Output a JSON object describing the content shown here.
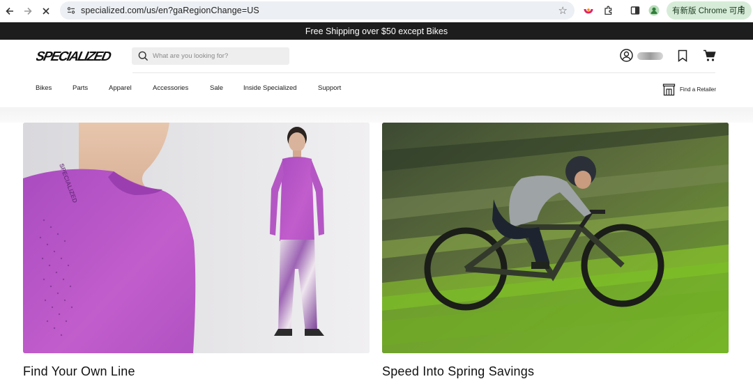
{
  "browser": {
    "url": "specialized.com/us/en?gaRegionChange=US",
    "update_button": "有新版 Chrome 可用",
    "icons": [
      "back-arrow-icon",
      "forward-arrow-icon",
      "stop-loading-icon",
      "site-info-icon",
      "bookmark-star-icon",
      "extension-icon",
      "puzzle-icon",
      "side-panel-icon",
      "profile-icon",
      "more-menu-icon"
    ]
  },
  "promo": {
    "text": "Free Shipping over $50 except Bikes"
  },
  "header": {
    "logo_text": "SPECIALIZED",
    "search_placeholder": "What are you looking for?",
    "menu": [
      "Bikes",
      "Parts",
      "Apparel",
      "Accessories",
      "Sale",
      "Inside Specialized",
      "Support"
    ],
    "retailer_label": "Find a Retailer"
  },
  "hero": {
    "cards": [
      {
        "title": "Find Your Own Line",
        "image": "Purple long-sleeve jersey and patterned pants on a model"
      },
      {
        "title": "Speed Into Spring Savings",
        "image": "Mountain biker riding through a motion-blurred green forest"
      }
    ]
  },
  "colors": {
    "promo_bg": "#1d1d1d",
    "update_pill_bg": "#d6ecd8",
    "jersey_purple": "#b955c4"
  }
}
